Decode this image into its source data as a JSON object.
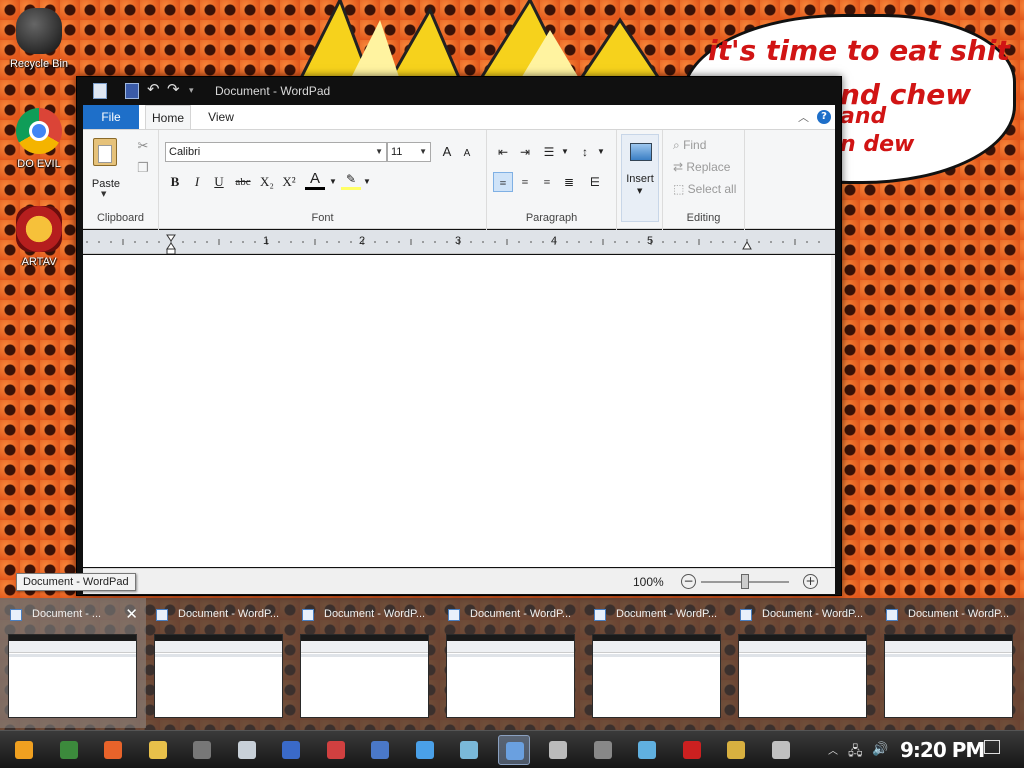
{
  "desktop": {
    "speech_bubble": {
      "line1": "it's time to eat shit",
      "line2": "nd chew",
      "line3": "and",
      "line4": "n dew"
    },
    "icons": [
      {
        "label": "Recycle Bin",
        "icon": "recycle-bin-icon"
      },
      {
        "label": "DO EVIL",
        "icon": "chrome-icon"
      },
      {
        "label": "ARTAV",
        "icon": "artav-emblem-icon"
      }
    ]
  },
  "window": {
    "title": "Document - WordPad",
    "tabs": {
      "file": "File",
      "home": "Home",
      "view": "View"
    },
    "help_glyph": "?",
    "ribbon": {
      "clipboard": {
        "paste": "Paste",
        "label": "Clipboard"
      },
      "font": {
        "family": "Calibri",
        "size": "11",
        "label": "Font",
        "buttons": {
          "bold": "B",
          "italic": "I",
          "underline": "U",
          "strike": "abc",
          "subscript": "X₂",
          "superscript": "X²",
          "color": "A",
          "grow": "A",
          "shrink": "A"
        }
      },
      "paragraph": {
        "label": "Paragraph"
      },
      "insert": {
        "label": "Insert"
      },
      "editing": {
        "find": "Find",
        "replace": "Replace",
        "select_all": "Select all",
        "label": "Editing"
      }
    },
    "ruler_numbers": [
      "1",
      "2",
      "3",
      "4",
      "5"
    ],
    "status": {
      "zoom": "100%",
      "zoom_out": "−",
      "zoom_in": "+",
      "zoom_level": 0.5
    }
  },
  "tooltip": "Document - WordPad",
  "thumbnails": [
    {
      "title": "Document - ...",
      "active": true
    },
    {
      "title": "Document - WordP..."
    },
    {
      "title": "Document - WordP..."
    },
    {
      "title": "Document - WordP..."
    },
    {
      "title": "Document - WordP..."
    },
    {
      "title": "Document - WordP..."
    },
    {
      "title": "Document - WordP..."
    }
  ],
  "taskbar": {
    "clock": "9:20 PM",
    "apps": [
      {
        "icon": "start-icon",
        "color": "#f0a020"
      },
      {
        "icon": "chrome-icon",
        "color": "#3c8a3c"
      },
      {
        "icon": "firefox-icon",
        "color": "#e8632a"
      },
      {
        "icon": "file-explorer-icon",
        "color": "#e8c04a"
      },
      {
        "icon": "tools-icon",
        "color": "#777777"
      },
      {
        "icon": "window-app-icon",
        "color": "#c8d0d8"
      },
      {
        "icon": "network-tower-icon",
        "color": "#3a6ac8"
      },
      {
        "icon": "calendar-app-icon",
        "color": "#d04040"
      },
      {
        "icon": "chart-app-icon",
        "color": "#4a78c8"
      },
      {
        "icon": "remote-desktop-icon",
        "color": "#4aa0e8"
      },
      {
        "icon": "glass-app-icon",
        "color": "#7ab8d8"
      },
      {
        "icon": "wordpad-icon",
        "color": "#6aa0e0"
      },
      {
        "icon": "disc-icon",
        "color": "#bbbbbb"
      },
      {
        "icon": "media-icon",
        "color": "#888888"
      },
      {
        "icon": "device-icon",
        "color": "#60b0e0"
      },
      {
        "icon": "opera-icon",
        "color": "#cc2020"
      },
      {
        "icon": "folder-icon",
        "color": "#d8b040"
      },
      {
        "icon": "archive-icon",
        "color": "#c0c0c0"
      }
    ]
  }
}
